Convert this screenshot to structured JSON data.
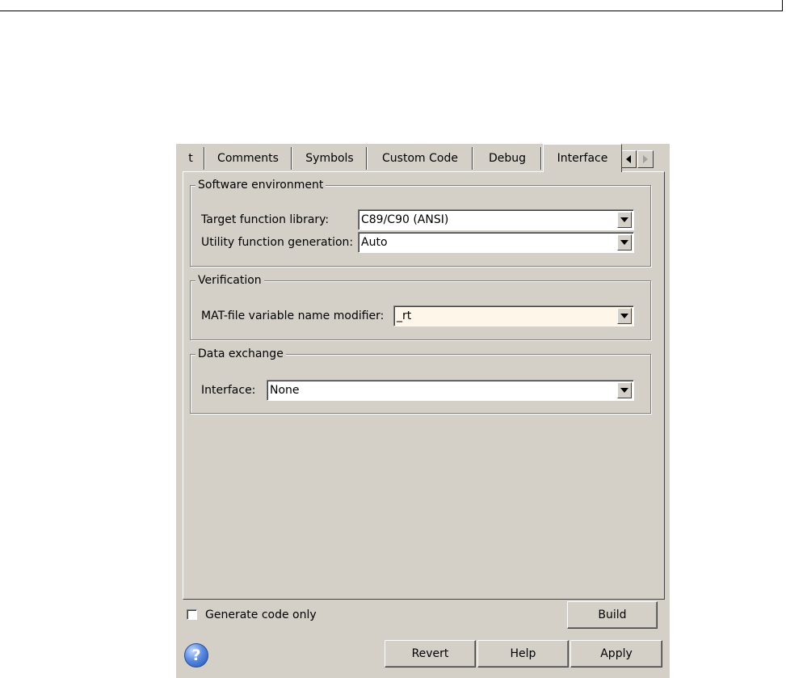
{
  "tabs": [
    {
      "label": "t",
      "active": false
    },
    {
      "label": "Comments",
      "active": false
    },
    {
      "label": "Symbols",
      "active": false
    },
    {
      "label": "Custom Code",
      "active": false
    },
    {
      "label": "Debug",
      "active": false
    },
    {
      "label": "Interface",
      "active": true
    }
  ],
  "groups": {
    "software_environment": {
      "title": "Software environment",
      "target_function_library_label": "Target function library:",
      "target_function_library_value": "C89/C90 (ANSI)",
      "utility_function_generation_label": "Utility function generation:",
      "utility_function_generation_value": "Auto"
    },
    "verification": {
      "title": "Verification",
      "mat_file_label": "MAT-file variable name modifier:",
      "mat_file_value": "_rt"
    },
    "data_exchange": {
      "title": "Data exchange",
      "interface_label": "Interface:",
      "interface_value": "None"
    }
  },
  "footer": {
    "generate_code_only_label": "Generate code only",
    "generate_code_only_checked": false,
    "build_label": "Build",
    "revert_label": "Revert",
    "help_label": "Help",
    "apply_label": "Apply",
    "help_icon_glyph": "?",
    "help_icon": "help-question-icon"
  },
  "colors": {
    "dialog_background": "#d4d0c8",
    "highlight_field": "#fdf6e9",
    "help_icon_blue": "#5b8be0"
  }
}
